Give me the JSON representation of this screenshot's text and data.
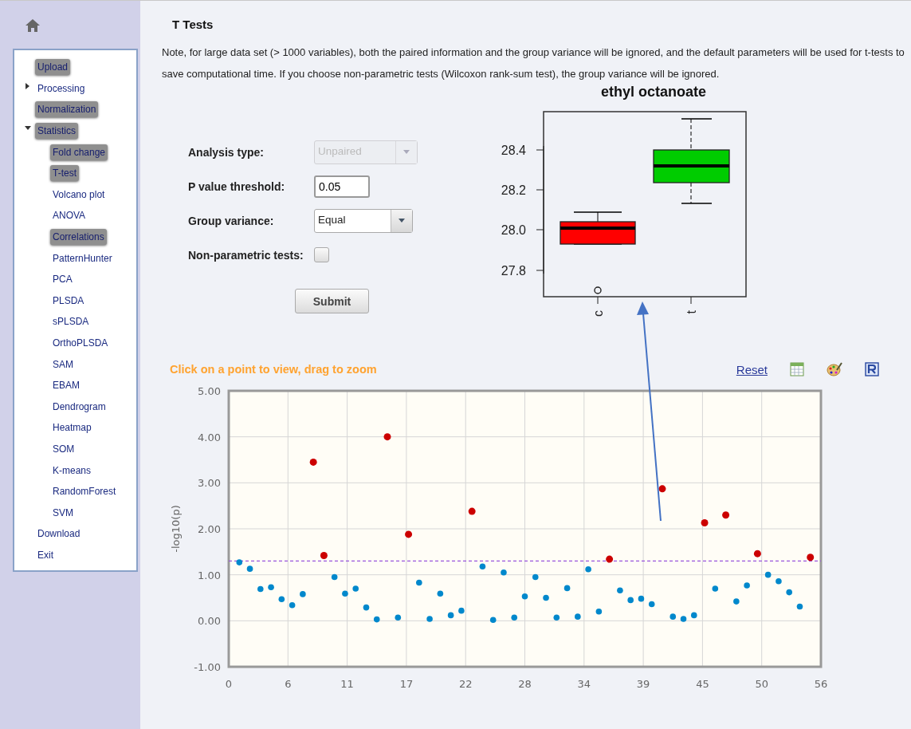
{
  "sidebar": {
    "items": [
      {
        "label": "Upload",
        "highlighted": true
      },
      {
        "label": "Processing",
        "highlighted": false,
        "expanded": false
      },
      {
        "label": "Normalization",
        "highlighted": true
      },
      {
        "label": "Statistics",
        "highlighted": true,
        "expanded": true,
        "children": [
          {
            "label": "Fold change",
            "highlighted": true
          },
          {
            "label": "T-test",
            "highlighted": true
          },
          {
            "label": "Volcano plot",
            "highlighted": false
          },
          {
            "label": "ANOVA",
            "highlighted": false
          },
          {
            "label": "Correlations",
            "highlighted": true
          },
          {
            "label": "PatternHunter",
            "highlighted": false
          },
          {
            "label": "PCA",
            "highlighted": false
          },
          {
            "label": "PLSDA",
            "highlighted": false
          },
          {
            "label": "sPLSDA",
            "highlighted": false
          },
          {
            "label": "OrthoPLSDA",
            "highlighted": false
          },
          {
            "label": "SAM",
            "highlighted": false
          },
          {
            "label": "EBAM",
            "highlighted": false
          },
          {
            "label": "Dendrogram",
            "highlighted": false
          },
          {
            "label": "Heatmap",
            "highlighted": false
          },
          {
            "label": "SOM",
            "highlighted": false
          },
          {
            "label": "K-means",
            "highlighted": false
          },
          {
            "label": "RandomForest",
            "highlighted": false
          },
          {
            "label": "SVM",
            "highlighted": false
          }
        ]
      },
      {
        "label": "Download",
        "highlighted": false
      },
      {
        "label": "Exit",
        "highlighted": false
      }
    ]
  },
  "page": {
    "title": "T Tests",
    "note": "Note, for large data set (> 1000 variables), both the paired information and the group variance will be ignored, and the default parameters will be used for t-tests to save computational time. If you choose non-parametric tests (Wilcoxon rank-sum test), the group variance will be ignored."
  },
  "form": {
    "fields": [
      {
        "kind": "select",
        "label": "Analysis type:",
        "value": "Unpaired",
        "disabled": true
      },
      {
        "kind": "input",
        "label": "P value threshold:",
        "value": "0.05"
      },
      {
        "kind": "select",
        "label": "Group variance:",
        "value": "Equal",
        "disabled": false
      },
      {
        "kind": "checkbox",
        "label": "Non-parametric tests:",
        "checked": false
      }
    ],
    "submit": "Submit"
  },
  "boxplot": {
    "title": "ethyl octanoate",
    "yticks": [
      "28.4",
      "28.2",
      "28.0",
      "27.8"
    ],
    "groups": [
      {
        "label": "c",
        "color": "#ff0000"
      },
      {
        "label": "t",
        "color": "#00cc00"
      }
    ]
  },
  "plot": {
    "hint": "Click on a point to view, drag to zoom",
    "reset": "Reset",
    "chart_data": {
      "type": "scatter",
      "ylabel": "-log10(p)",
      "x": [
        1,
        2,
        3,
        4,
        5,
        6,
        7,
        8,
        9,
        10,
        11,
        12,
        13,
        14,
        15,
        16,
        17,
        18,
        19,
        20,
        21,
        22,
        23,
        24,
        25,
        26,
        27,
        28,
        29,
        30,
        31,
        32,
        33,
        34,
        35,
        36,
        37,
        38,
        39,
        40,
        41,
        42,
        43,
        44,
        45,
        46,
        47,
        48,
        49,
        50,
        51,
        52,
        53,
        54,
        55
      ],
      "series": [
        {
          "color": "#cc0000",
          "values": [
            null,
            null,
            null,
            null,
            null,
            null,
            null,
            3.45,
            1.42,
            null,
            null,
            null,
            null,
            null,
            4.0,
            null,
            1.88,
            null,
            null,
            null,
            null,
            null,
            2.38,
            null,
            null,
            null,
            null,
            null,
            null,
            null,
            null,
            null,
            null,
            null,
            null,
            1.34,
            null,
            null,
            null,
            null,
            2.87,
            null,
            null,
            null,
            2.13,
            null,
            2.3,
            null,
            null,
            1.46,
            null,
            null,
            null,
            null,
            1.38
          ]
        },
        {
          "color": "#0088cc",
          "values": [
            1.27,
            1.13,
            0.69,
            0.73,
            0.47,
            0.34,
            0.58,
            null,
            null,
            0.95,
            0.59,
            0.7,
            0.29,
            0.03,
            null,
            0.07,
            null,
            0.83,
            0.04,
            0.59,
            0.12,
            0.22,
            null,
            1.18,
            0.02,
            1.05,
            0.07,
            0.53,
            0.95,
            0.5,
            0.07,
            0.71,
            0.09,
            1.12,
            0.2,
            null,
            0.66,
            0.45,
            0.48,
            0.36,
            null,
            0.09,
            0.04,
            0.12,
            null,
            0.7,
            null,
            0.42,
            0.77,
            null,
            1.0,
            0.86,
            0.62,
            0.31,
            null
          ]
        }
      ],
      "xlim": [
        0,
        56
      ],
      "ylim": [
        -1,
        5
      ],
      "grid": true,
      "xticks": [
        {
          "value": 0,
          "label": "0"
        },
        {
          "value": 5.6,
          "label": "6"
        },
        {
          "value": 11.2,
          "label": "11"
        },
        {
          "value": 16.8,
          "label": "17"
        },
        {
          "value": 22.4,
          "label": "22"
        },
        {
          "value": 28,
          "label": "28"
        },
        {
          "value": 33.6,
          "label": "34"
        },
        {
          "value": 39.2,
          "label": "39"
        },
        {
          "value": 44.8,
          "label": "45"
        },
        {
          "value": 50.4,
          "label": "50"
        },
        {
          "value": 56,
          "label": "56"
        }
      ],
      "yticks": [
        {
          "value": 5,
          "label": "5.00"
        },
        {
          "value": 4,
          "label": "4.00"
        },
        {
          "value": 3,
          "label": "3.00"
        },
        {
          "value": 2,
          "label": "2.00"
        },
        {
          "value": 1,
          "label": "1.00"
        },
        {
          "value": 0,
          "label": "0.00"
        },
        {
          "value": -1,
          "label": "-1.00"
        }
      ],
      "ref_lines": [
        {
          "axis": "y",
          "value": 1.3
        }
      ]
    }
  }
}
